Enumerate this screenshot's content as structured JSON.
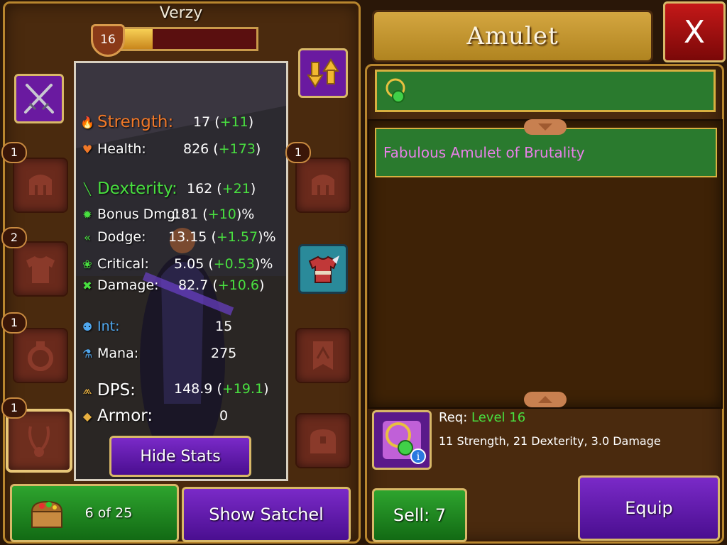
{
  "hero": {
    "name": "Verzy",
    "level": "16",
    "xp_fraction": 0.24
  },
  "left_slots": [
    {
      "icon": "helmet-icon",
      "count": "1"
    },
    {
      "icon": "armor-icon",
      "count": "2"
    },
    {
      "icon": "ring-icon",
      "count": "1"
    },
    {
      "icon": "amulet-icon",
      "count": "1"
    }
  ],
  "right_slots": [
    {
      "icon": "helmet-icon",
      "count": "1"
    },
    {
      "icon": "chest-armor-icon"
    },
    {
      "icon": "banner-icon"
    },
    {
      "icon": "chest-icon"
    }
  ],
  "stats": [
    {
      "label": "Strength:",
      "value": "17",
      "bonus": "+11",
      "suffix": "",
      "icon": "flame-icon",
      "color": "#f07828"
    },
    {
      "label": "Health:",
      "value": "826",
      "bonus": "+173",
      "suffix": "",
      "icon": "heart-icon",
      "color": "#f07828"
    },
    {
      "label": "Dexterity:",
      "value": "162",
      "bonus": "+21",
      "suffix": "",
      "icon": "slash-icon",
      "color": "#49e040"
    },
    {
      "label": "Bonus Dmg:",
      "value": "181",
      "bonus": "+10",
      "suffix": "%",
      "icon": "burst-icon",
      "color": "#49e040"
    },
    {
      "label": "Dodge:",
      "value": "13.15",
      "bonus": "+1.57",
      "suffix": "%",
      "icon": "chevron-icon",
      "color": "#49e040"
    },
    {
      "label": "Critical:",
      "value": "5.05",
      "bonus": "+0.53",
      "suffix": "%",
      "icon": "critical-icon",
      "color": "#49e040"
    },
    {
      "label": "Damage:",
      "value": "82.7",
      "bonus": "+10.6",
      "suffix": "",
      "icon": "cross-swords-icon",
      "color": "#49e040"
    },
    {
      "label": "Int:",
      "value": "15",
      "bonus": "",
      "suffix": "",
      "icon": "int-icon",
      "color": "#50a8f0"
    },
    {
      "label": "Mana:",
      "value": "275",
      "bonus": "",
      "suffix": "",
      "icon": "potion-icon",
      "color": "#50a8f0"
    },
    {
      "label": "DPS:",
      "value": "148.9",
      "bonus": "+19.1",
      "suffix": "",
      "icon": "dps-icon",
      "color": "#e8b040"
    },
    {
      "label": "Armor:",
      "value": "0",
      "bonus": "",
      "suffix": "",
      "icon": "shield-icon",
      "color": "#e8b040"
    }
  ],
  "buttons": {
    "hide_stats": "Hide Stats",
    "inventory_count": "6 of 25",
    "show_satchel": "Show Satchel",
    "sell_label": "Sell:",
    "sell_value": "7",
    "equip": "Equip",
    "close": "X"
  },
  "category_title": "Amulet",
  "items": [
    {
      "name": "Fabulous Amulet of Brutality",
      "color": "#e880e8"
    }
  ],
  "selected_item": {
    "req_label": "Req:",
    "req_level": "Level 16",
    "description": "11 Strength, 21 Dexterity, 3.0 Damage"
  },
  "colors": {
    "bonus_green": "#49e040",
    "item_name_pink": "#e880e8",
    "panel_brown": "#4a2a0e",
    "gold_border": "#d8b868"
  }
}
